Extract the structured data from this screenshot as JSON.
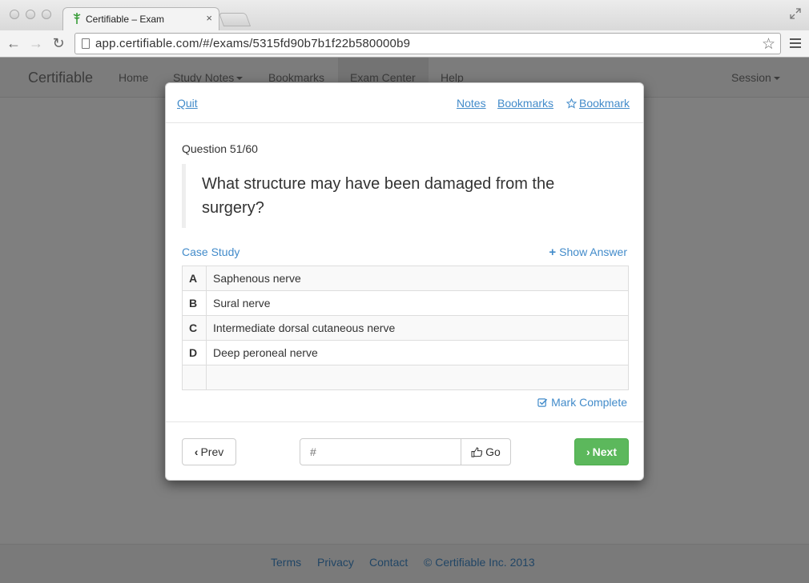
{
  "browser": {
    "tab_title": "Certifiable – Exam",
    "url": "app.certifiable.com/#/exams/5315fd90b7b1f22b580000b9"
  },
  "navbar": {
    "brand": "Certifiable",
    "items": [
      "Home",
      "Study Notes",
      "Bookmarks",
      "Exam Center",
      "Help"
    ],
    "session": "Session"
  },
  "footer": {
    "links": [
      "Terms",
      "Privacy",
      "Contact"
    ],
    "copyright": "© Certifiable Inc. 2013"
  },
  "modal": {
    "quit": "Quit",
    "notes": "Notes",
    "bookmarks": "Bookmarks",
    "bookmark": "Bookmark",
    "question_number": "Question 51/60",
    "question_text": "What structure may have been damaged from the surgery?",
    "case_study": "Case Study",
    "show_answer": "Show Answer",
    "answers": [
      {
        "letter": "A",
        "text": "Saphenous nerve"
      },
      {
        "letter": "B",
        "text": "Sural nerve"
      },
      {
        "letter": "C",
        "text": "Intermediate dorsal cutaneous nerve"
      },
      {
        "letter": "D",
        "text": "Deep peroneal nerve"
      },
      {
        "letter": "",
        "text": ""
      }
    ],
    "mark_complete": "Mark Complete",
    "prev": "Prev",
    "goto_placeholder": "#",
    "go": "Go",
    "next": "Next"
  },
  "colors": {
    "link": "#428bca",
    "success": "#5cb85c",
    "favicon": "#3a9d3a"
  },
  "icons": [
    "back-arrow-icon",
    "forward-arrow-icon",
    "reload-icon",
    "page-icon",
    "star-icon",
    "menu-icon",
    "fullscreen-icon",
    "caduceus-favicon-icon",
    "plus-icon",
    "checkbox-icon",
    "hand-pointer-icon",
    "chevron-left-icon",
    "chevron-right-icon"
  ]
}
